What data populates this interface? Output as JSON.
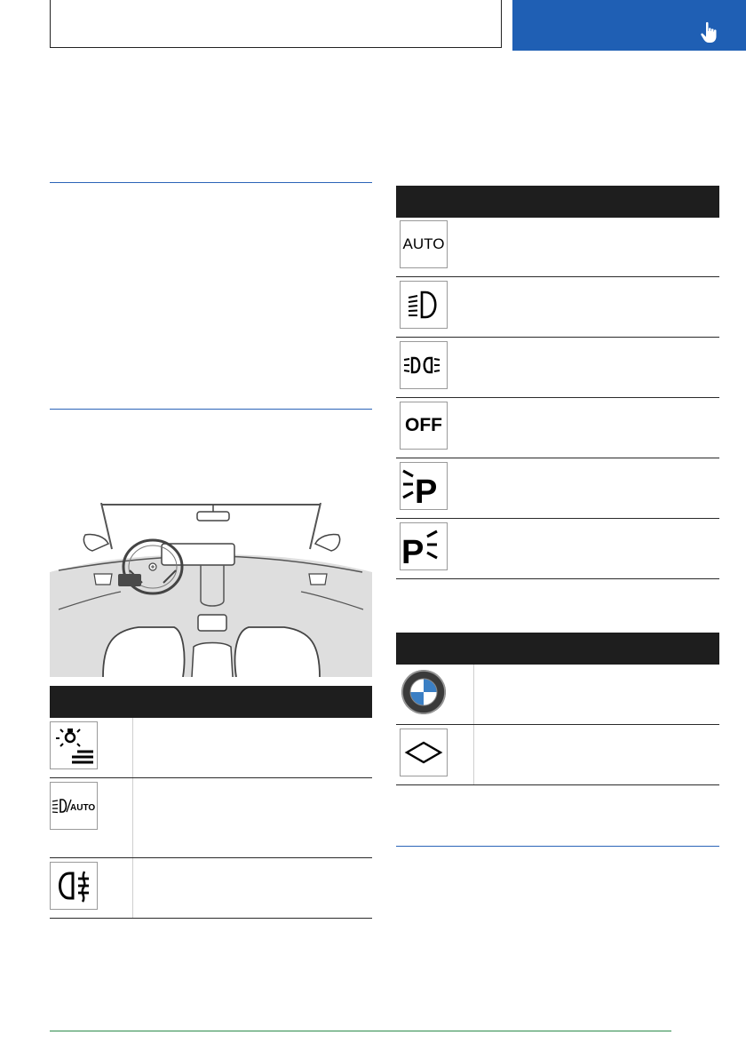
{
  "header": {
    "tab_color": "#1f5fb4",
    "tab_icon": "pointing-hand-icon"
  },
  "left_table": {
    "icons": [
      "headlight-flasher-settings-icon",
      "low-beam-auto-icon",
      "rear-fog-light-icon"
    ]
  },
  "right_table_1": {
    "icons": [
      "auto-icon",
      "low-beam-icon",
      "parking-lights-icon",
      "off-icon",
      "parking-light-left-icon",
      "parking-light-right-icon"
    ],
    "auto_label": "AUTO",
    "off_label": "OFF",
    "p_label": "P",
    "left_auto_label": "AUTO"
  },
  "right_table_2": {
    "icons": [
      "bmw-logo-icon",
      "diamond-icon"
    ]
  }
}
